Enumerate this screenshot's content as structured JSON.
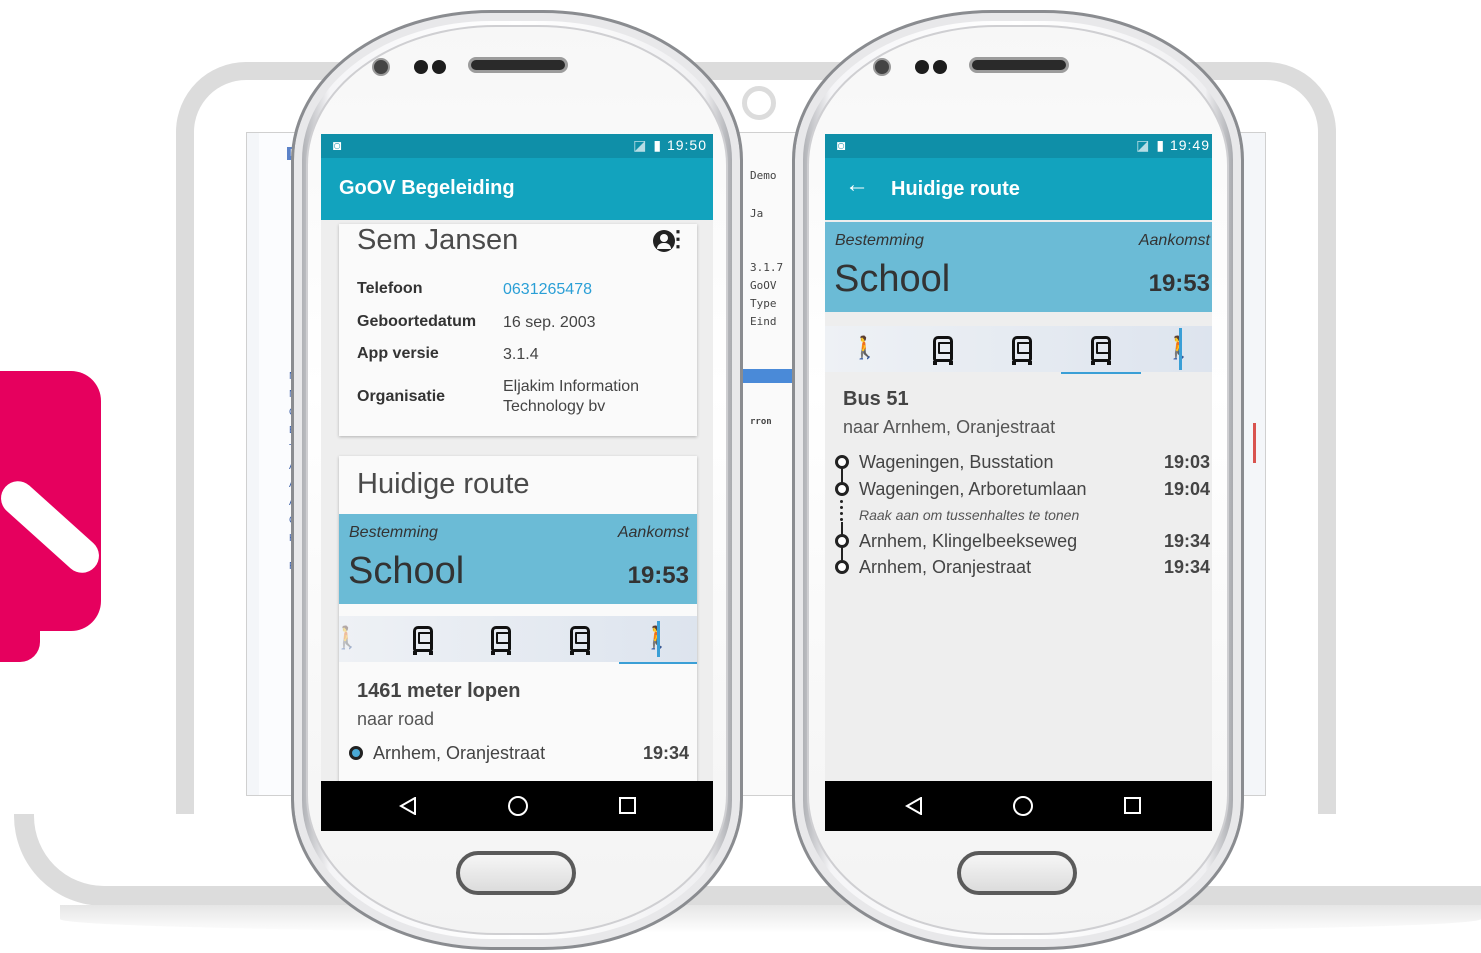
{
  "laptop_screen": {
    "left_tag": "Re",
    "left_items": [
      "M",
      "N",
      "O",
      "Be",
      "To",
      "Al",
      "Ap",
      "A",
      "C",
      "H",
      "Ri"
    ],
    "center_lines": [
      "Demo",
      "Ja",
      "3.1.7",
      "GoOV",
      "Type",
      "Eind",
      "rron"
    ]
  },
  "phone_left": {
    "status": {
      "time": "19:50",
      "icons": "◪ 🔋"
    },
    "app_title": "GoOV Begeleiding",
    "profile": {
      "name": "Sem Jansen",
      "rows": [
        {
          "label": "Telefoon",
          "value": "0631265478"
        },
        {
          "label": "Geboortedatum",
          "value": "16 sep. 2003"
        },
        {
          "label": "App versie",
          "value": "3.1.4"
        },
        {
          "label": "Organisatie",
          "value": "Eljakim Information Technology bv"
        }
      ]
    },
    "route_card": {
      "title": "Huidige route",
      "dest_label": "Bestemming",
      "arrival_label": "Aankomst",
      "destination": "School",
      "arrival": "19:53",
      "leg_title": "1461 meter lopen",
      "leg_sub": "naar road",
      "stop_name": "Arnhem, Oranjestraat",
      "stop_time": "19:34"
    }
  },
  "phone_right": {
    "status": {
      "time": "19:49"
    },
    "app_title": "Huidige route",
    "back_icon": "←",
    "dest_label": "Bestemming",
    "arrival_label": "Aankomst",
    "destination": "School",
    "arrival": "19:53",
    "leg_title": "Bus 51",
    "leg_sub": "naar Arnhem, Oranjestraat",
    "stops": [
      {
        "name": "Wageningen, Busstation",
        "time": "19:03"
      },
      {
        "name": "Wageningen, Arboretumlaan",
        "time": "19:04"
      },
      {
        "name": "Arnhem, Klingelbeekseweg",
        "time": "19:34"
      },
      {
        "name": "Arnhem, Oranjestraat",
        "time": "19:34"
      }
    ],
    "hint": "Raak aan om tussenhaltes te tonen"
  },
  "colors": {
    "status_bar": "#0f8fa8",
    "app_bar": "#12a3be",
    "destination_box": "#6bbbd6",
    "link": "#2a9fd6",
    "logo": "#e6005e"
  },
  "icons": {
    "walk": "🚶",
    "bus": "bus-icon",
    "nav": [
      "back-triangle",
      "home-circle",
      "recents-square"
    ]
  }
}
